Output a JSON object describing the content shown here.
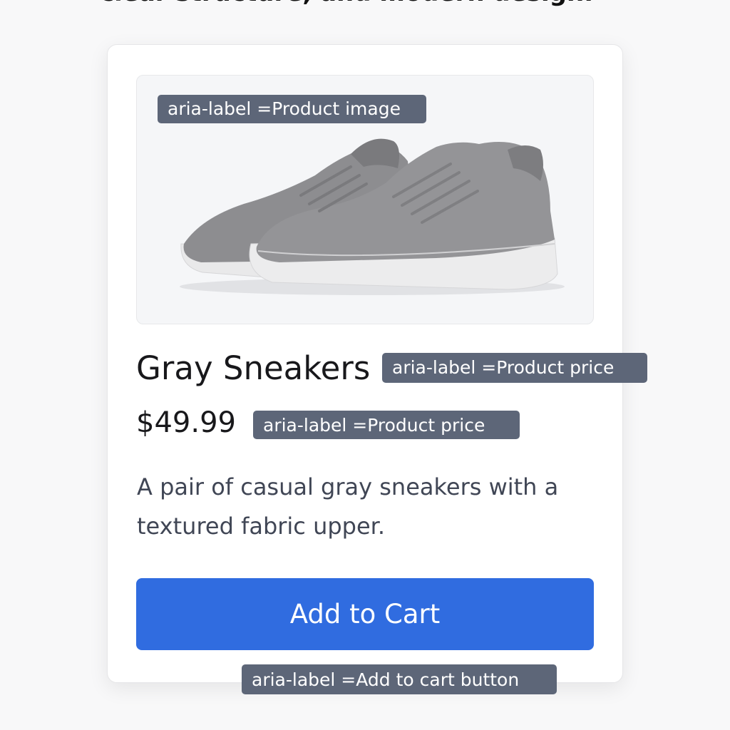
{
  "page": {
    "heading": "clear structure, and modern design."
  },
  "product": {
    "image_alt": "Gray sneakers",
    "name": "Gray Sneakers",
    "price": "$49.99",
    "description": "A pair of casual gray sneakers with a textured fabric upper.",
    "cart_button_label": "Add to Cart"
  },
  "annotations": {
    "image": "aria-label =Product image",
    "name": "aria-label =Product price",
    "price": "aria-label =Product price",
    "cart_button": "aria-label =Add to cart button"
  },
  "colors": {
    "accent": "#306ce0",
    "annotation_bg": "#5d6678",
    "card_bg": "#ffffff",
    "page_bg": "#f8f8f9"
  }
}
